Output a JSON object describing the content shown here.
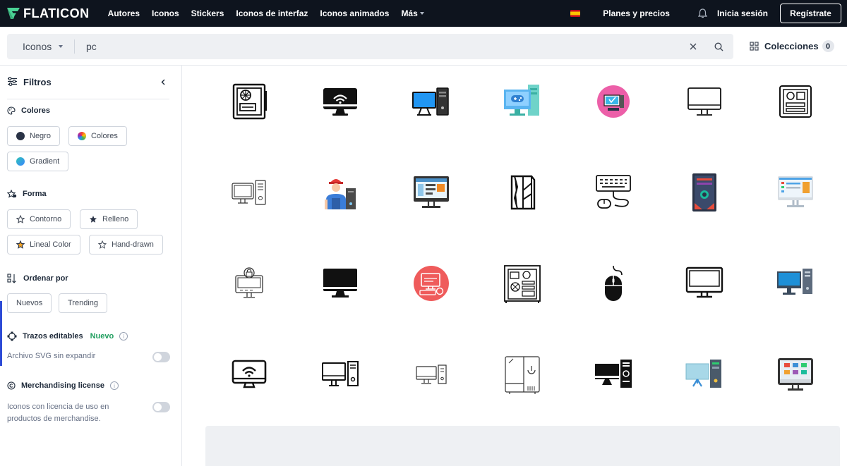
{
  "brand": {
    "name": "FLATICON",
    "accent": "#4ad295"
  },
  "nav": {
    "links": [
      "Autores",
      "Iconos",
      "Stickers",
      "Iconos de interfaz",
      "Iconos animados"
    ],
    "more": "Más",
    "plans": "Planes y precios",
    "login": "Inicia sesión",
    "register": "Regístrate"
  },
  "search": {
    "type": "Iconos",
    "query": "pc",
    "collections": "Colecciones",
    "collections_count": "0"
  },
  "sidebar": {
    "filters": "Filtros",
    "colors_title": "Colores",
    "colors": [
      "Negro",
      "Colores",
      "Gradient"
    ],
    "shape_title": "Forma",
    "shapes": [
      "Contorno",
      "Relleno",
      "Lineal Color",
      "Hand-drawn"
    ],
    "sort_title": "Ordenar por",
    "sort": [
      "Nuevos",
      "Trending"
    ],
    "editable_title": "Trazos editables",
    "editable_new": "Nuevo",
    "editable_note": "Archivo SVG sin expandir",
    "merch_title": "Merchandising license",
    "merch_note_1": "Iconos con licencia de uso en",
    "merch_note_2": "productos de merchandise."
  },
  "icons": [
    "power-supply-icon",
    "wifi-monitor-filled-icon",
    "desktop-pc-blue-icon",
    "game-monitor-icon",
    "pc-circle-pink-icon",
    "monitor-outline-icon",
    "pc-case-outline-icon",
    "computer-outline-thin-icon",
    "technician-icon",
    "web-monitor-icon",
    "pc-case-lines-icon",
    "keyboard-mouse-icon",
    "gaming-tower-icon",
    "dashboard-monitor-icon",
    "locked-computer-icon",
    "imac-filled-icon",
    "pc-circle-red-icon",
    "motherboard-case-icon",
    "mouse-filled-icon",
    "monitor-thick-icon",
    "desktop-blue-icon",
    "wifi-monitor-outline-icon",
    "desktop-tower-outline-icon",
    "desktop-tower-thin-icon",
    "pc-tower-power-icon",
    "desktop-black-filled-icon",
    "desktop-lightblue-icon",
    "app-monitor-icon"
  ]
}
